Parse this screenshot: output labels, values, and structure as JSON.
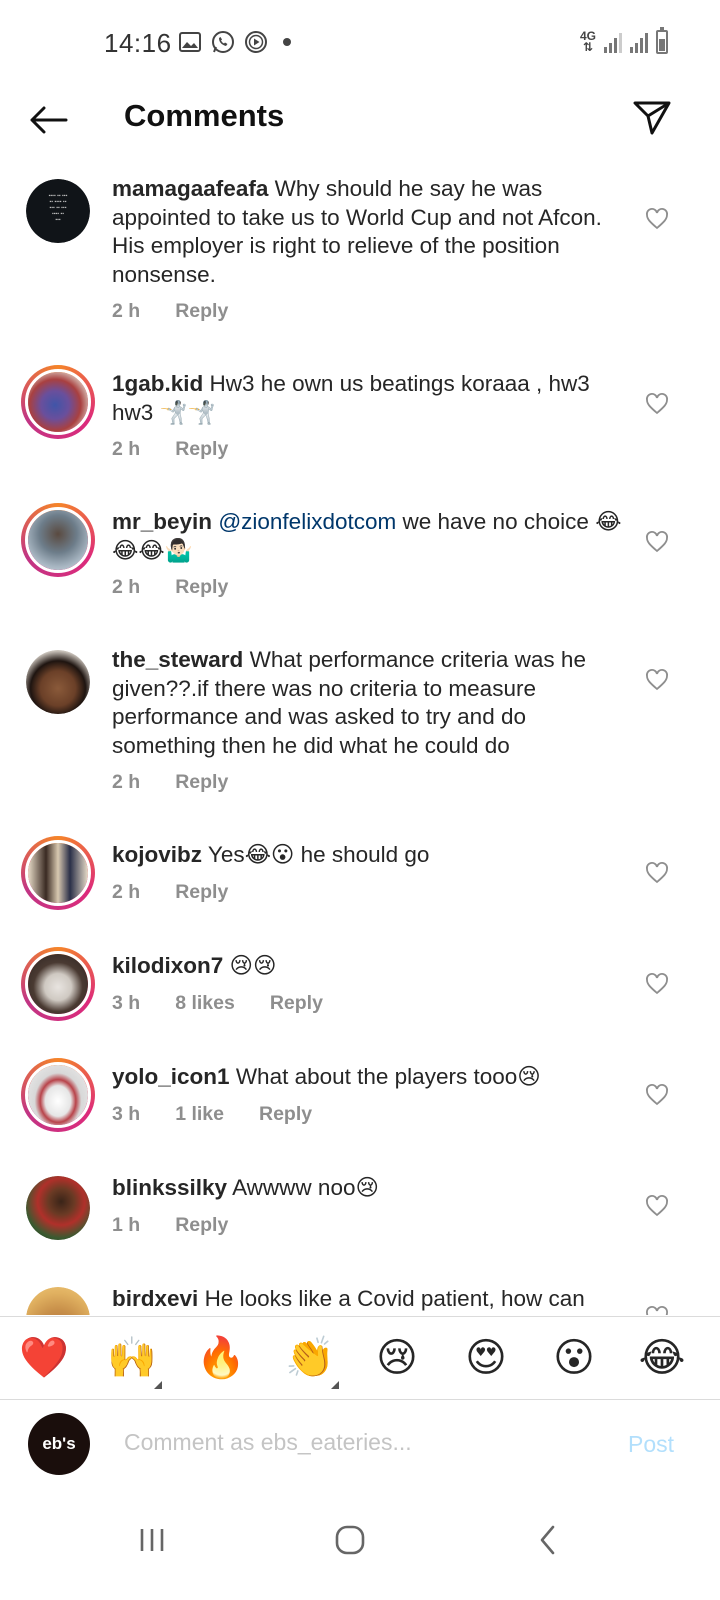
{
  "status_bar": {
    "time": "14:16",
    "network": "4G"
  },
  "header": {
    "title": "Comments"
  },
  "comments": [
    {
      "username": "mamagaafeafa",
      "text": "Why should he say he was appointed to take us to World Cup and not Afcon. His employer is right to relieve of the position nonsense.",
      "time": "2 h",
      "likes": "",
      "reply": "Reply"
    },
    {
      "username": "1gab.kid",
      "text": "Hw3 he own us beatings koraaa , hw3 hw3 🤺🤺",
      "time": "2 h",
      "likes": "",
      "reply": "Reply"
    },
    {
      "username": "mr_beyin",
      "mention": "@zionfelixdotcom",
      "text": "we have no choice 😂😂😂🤷🏻‍♂️",
      "time": "2 h",
      "likes": "",
      "reply": "Reply"
    },
    {
      "username": "the_steward",
      "text": "What performance criteria was he given??.if there was no criteria to  measure performance and was asked to try and do something then he did what he could do",
      "time": "2 h",
      "likes": "",
      "reply": "Reply"
    },
    {
      "username": "kojovibz",
      "text": "Yes😂😮 he should go",
      "time": "2 h",
      "likes": "",
      "reply": "Reply"
    },
    {
      "username": "kilodixon7",
      "text": "😢😢",
      "time": "3 h",
      "likes": "8 likes",
      "reply": "Reply"
    },
    {
      "username": "yolo_icon1",
      "text": "What about the players tooo😢",
      "time": "3 h",
      "likes": "1 like",
      "reply": "Reply"
    },
    {
      "username": "blinkssilky",
      "text": "Awwww noo😢",
      "time": "1 h",
      "likes": "",
      "reply": "Reply"
    },
    {
      "username": "birdxevi",
      "text": "He looks like a Covid patient, how can",
      "time": "",
      "likes": "",
      "reply": ""
    }
  ],
  "reactions": [
    "❤️",
    "🙌",
    "🔥",
    "👏",
    "😢",
    "😍",
    "😮",
    "😂"
  ],
  "composer": {
    "avatar_text": "eb's",
    "placeholder": "Comment as ebs_eateries...",
    "post_label": "Post"
  },
  "colors": {
    "like_outline": "#8e8e8e",
    "mention": "#00376b",
    "post_disabled": "#b2dffc",
    "meta": "#8e8e8e"
  }
}
